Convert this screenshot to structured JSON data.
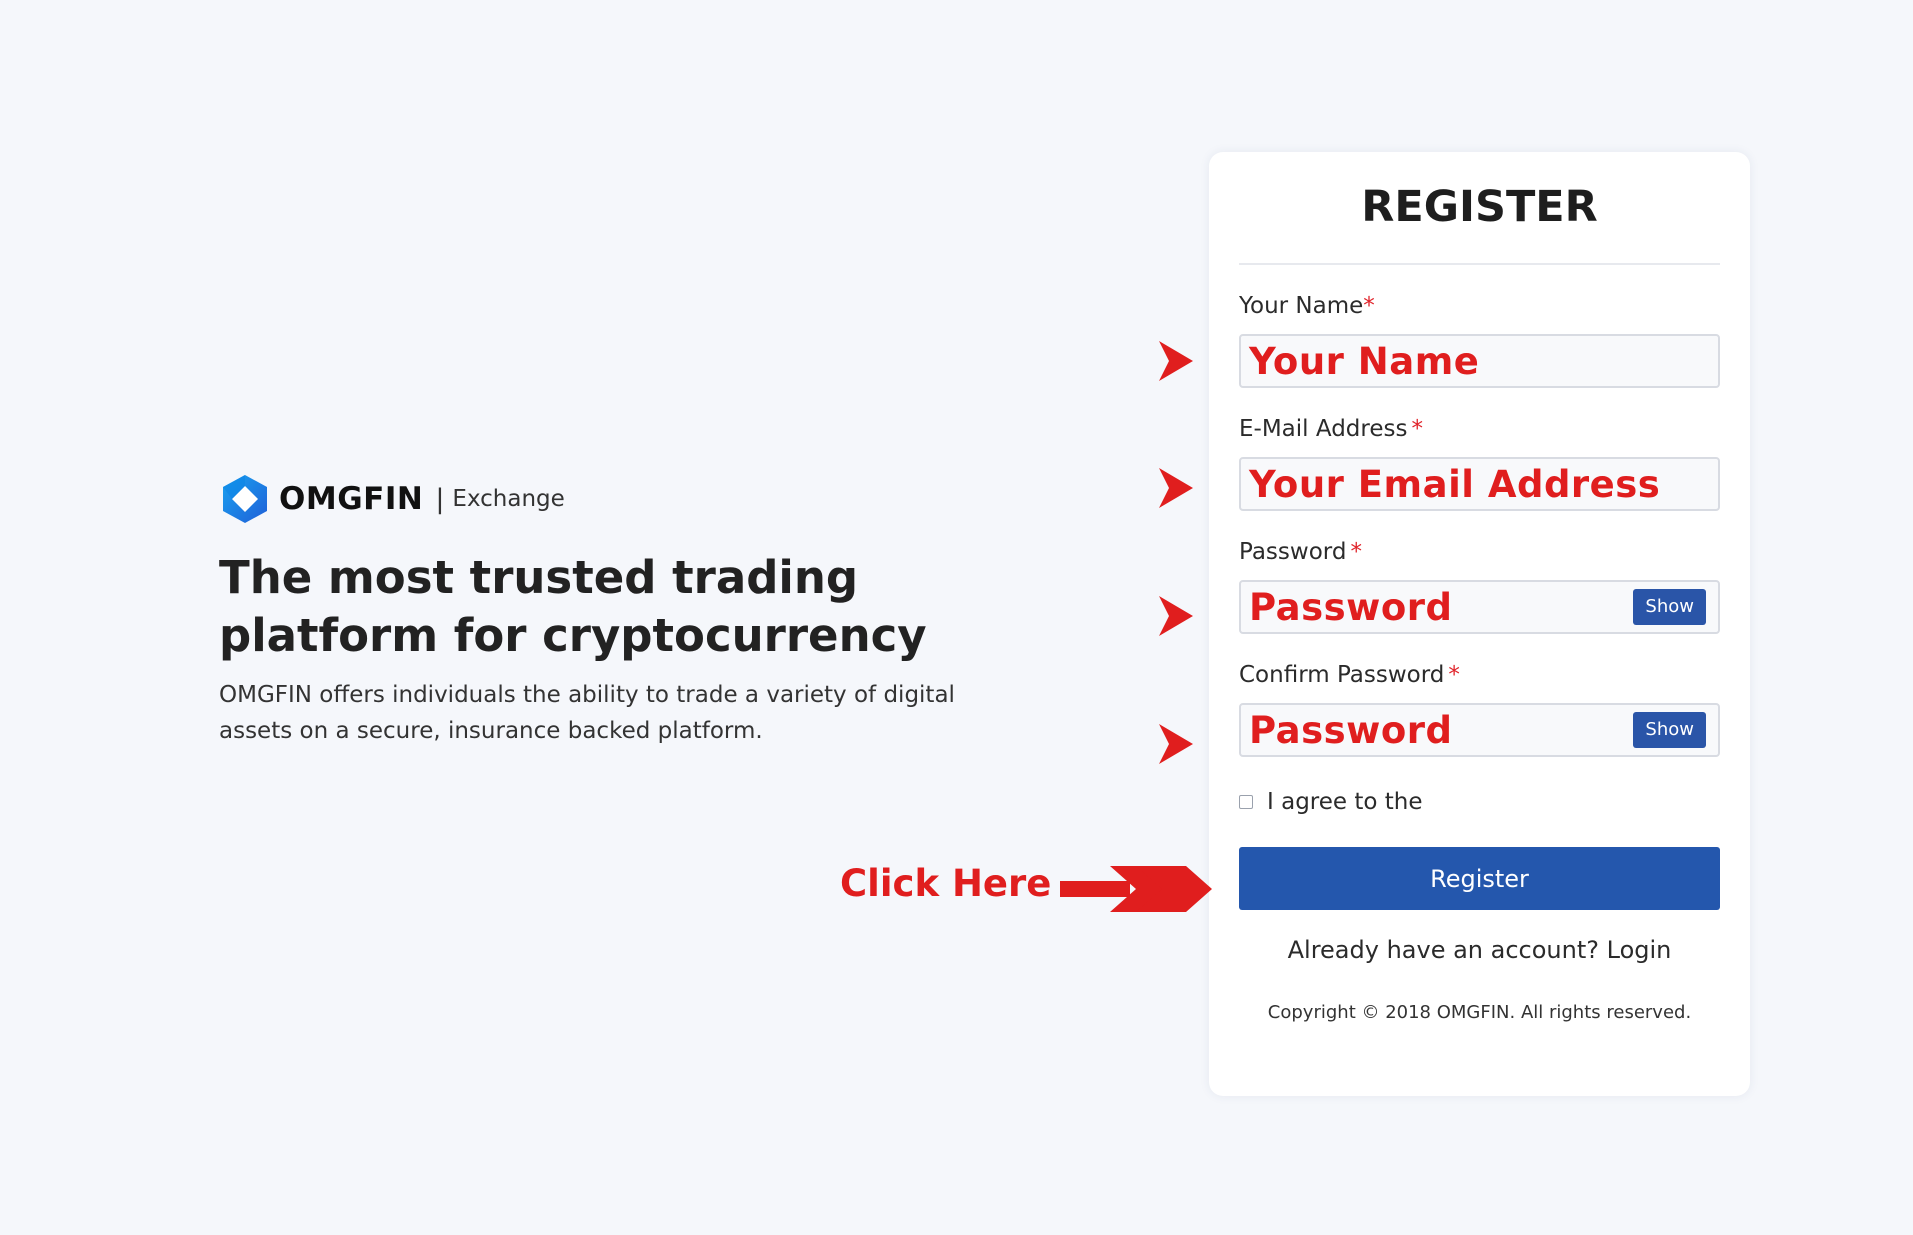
{
  "brand": {
    "name": "OMGFIN",
    "separator": "|",
    "subtitle": "Exchange"
  },
  "hero": {
    "headline": "The most trusted trading platform for cryptocurrency",
    "tagline": "OMGFIN offers individuals the ability to trade a variety of digital assets on a secure, insurance backed platform."
  },
  "form": {
    "title": "REGISTER",
    "required_marker": "*",
    "fields": [
      {
        "label": "Your Name",
        "value": "Your Name"
      },
      {
        "label": "E-Mail Address",
        "value": "Your Email Address"
      },
      {
        "label": "Password",
        "value": "Password",
        "toggle_label": "Show"
      },
      {
        "label": "Confirm Password",
        "value": "Password",
        "toggle_label": "Show"
      }
    ],
    "agree_text": "I agree to the",
    "agree_checked": false,
    "submit_label": "Register",
    "login_prompt": "Already have an account? Login",
    "copyright": "Copyright © 2018 OMGFIN. All rights reserved."
  },
  "annotation": {
    "click_here": "Click Here",
    "color": "#e01e1e"
  },
  "colors": {
    "background": "#f5f7fb",
    "primary_button": "#2457ad",
    "show_button": "#2a55a8",
    "required": "#e0232a"
  }
}
